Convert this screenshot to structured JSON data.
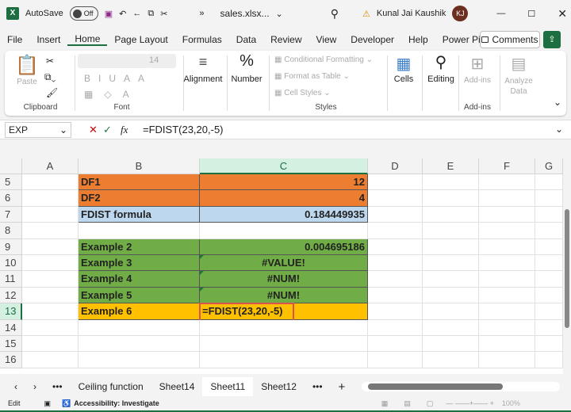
{
  "titlebar": {
    "autosave": "AutoSave",
    "toggle": "Off",
    "filename": "sales.xlsx...",
    "user": "Kunal Jai Kaushik",
    "initials": "KJ"
  },
  "menu": [
    "File",
    "Insert",
    "Home",
    "Page Layout",
    "Formulas",
    "Data",
    "Review",
    "View",
    "Developer",
    "Help",
    "Power Pivot"
  ],
  "comments": "Comments",
  "ribbon": {
    "paste": "Paste",
    "clipboard": "Clipboard",
    "font_size": "14",
    "font": "Font",
    "alignment": "Alignment",
    "number": "Number",
    "cond": "Conditional Formatting",
    "fmt_table": "Format as Table",
    "cell_styles": "Cell Styles",
    "styles": "Styles",
    "cells": "Cells",
    "editing": "Editing",
    "addins": "Add-ins",
    "addins_group": "Add-ins",
    "analyze": "Analyze Data"
  },
  "formula_bar": {
    "name_box": "EXP",
    "fx": "fx",
    "formula": "=FDIST(23,20,-5)"
  },
  "columns": [
    "A",
    "B",
    "C",
    "D",
    "E",
    "F",
    "G"
  ],
  "rows": [
    "5",
    "6",
    "7",
    "8",
    "9",
    "10",
    "11",
    "12",
    "13",
    "14",
    "15",
    "16"
  ],
  "cells": [
    {
      "row": "5",
      "b": "DF1",
      "c": "12",
      "color": "#ED7D31",
      "align": "r"
    },
    {
      "row": "6",
      "b": "DF2",
      "c": "4",
      "color": "#ED7D31",
      "align": "r"
    },
    {
      "row": "7",
      "b": "FDIST formula",
      "c": "0.184449935",
      "color": "#BDD7EE",
      "align": "r"
    },
    {
      "row": "9",
      "b": "Example 2",
      "c": "0.004695186",
      "color": "#70AD47",
      "align": "r"
    },
    {
      "row": "10",
      "b": "Example 3",
      "c": "#VALUE!",
      "color": "#70AD47",
      "align": "c",
      "tri": true
    },
    {
      "row": "11",
      "b": "Example 4",
      "c": "#NUM!",
      "color": "#70AD47",
      "align": "c",
      "tri": true
    },
    {
      "row": "12",
      "b": "Example 5",
      "c": "#NUM!",
      "color": "#70AD47",
      "align": "c",
      "tri": true
    },
    {
      "row": "13",
      "b": "Example 6",
      "c": "=FDIST(23,20,-5)",
      "color": "#FFC000",
      "align": "l",
      "editing": true
    }
  ],
  "sheets": {
    "more": "•••",
    "tabs": [
      "Ceiling function",
      "Sheet14",
      "Sheet11",
      "Sheet12"
    ],
    "active": "Sheet11",
    "add": "+"
  },
  "status": {
    "mode": "Edit",
    "accessibility": "Accessibility: Investigate",
    "zoom": "100%"
  }
}
